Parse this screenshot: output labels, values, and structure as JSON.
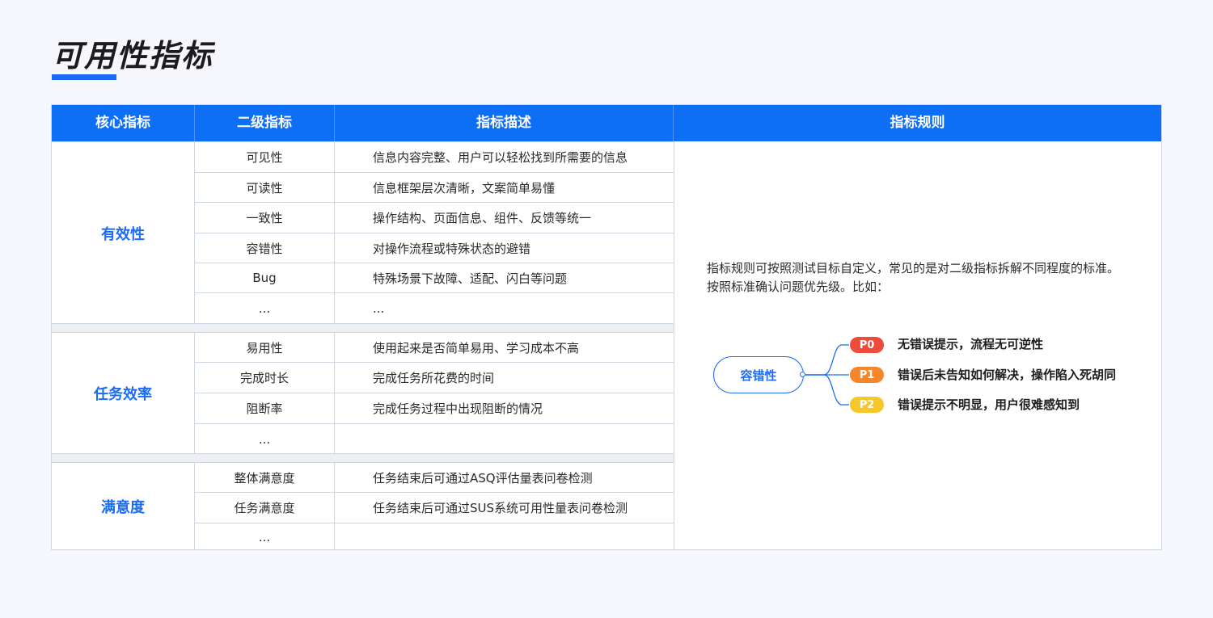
{
  "page": {
    "title": "可用性指标"
  },
  "table": {
    "headers": [
      "核心指标",
      "二级指标",
      "指标描述",
      "指标规则"
    ],
    "groups": [
      {
        "core": "有效性",
        "rows": [
          {
            "secondary": "可见性",
            "description": "信息内容完整、用户可以轻松找到所需要的信息"
          },
          {
            "secondary": "可读性",
            "description": "信息框架层次清晰，文案简单易懂"
          },
          {
            "secondary": "一致性",
            "description": "操作结构、页面信息、组件、反馈等统一"
          },
          {
            "secondary": "容错性",
            "description": "对操作流程或特殊状态的避错"
          },
          {
            "secondary": "Bug",
            "description": "特殊场景下故障、适配、闪白等问题"
          },
          {
            "secondary": "...",
            "description": "..."
          }
        ]
      },
      {
        "core": "任务效率",
        "rows": [
          {
            "secondary": "易用性",
            "description": "使用起来是否简单易用、学习成本不高"
          },
          {
            "secondary": "完成时长",
            "description": "完成任务所花费的时间"
          },
          {
            "secondary": "阻断率",
            "description": "完成任务过程中出现阻断的情况"
          },
          {
            "secondary": "...",
            "description": ""
          }
        ]
      },
      {
        "core": "满意度",
        "rows": [
          {
            "secondary": "整体满意度",
            "description": "任务结束后可通过ASQ评估量表问卷检测"
          },
          {
            "secondary": "任务满意度",
            "description": "任务结束后可通过SUS系统可用性量表问卷检测"
          },
          {
            "secondary": "...",
            "description": ""
          }
        ]
      }
    ],
    "rule": {
      "text_line1": "指标规则可按照测试目标自定义，常见的是对二级指标拆解不同程度的标准。",
      "text_line2": "按照标准确认问题优先级。比如：",
      "example": {
        "node": "容错性",
        "levels": [
          {
            "badge": "P0",
            "text": "无错误提示，流程无可逆性",
            "color": "#f04a3c"
          },
          {
            "badge": "P1",
            "text": "错误后未告知如何解决，操作陷入死胡同",
            "color": "#f5862a"
          },
          {
            "badge": "P2",
            "text": "错误提示不明显，用户很难感知到",
            "color": "#f5c72a"
          }
        ]
      }
    }
  },
  "colors": {
    "accent": "#1a6cf5",
    "header_bg": "#0d6ef6"
  }
}
